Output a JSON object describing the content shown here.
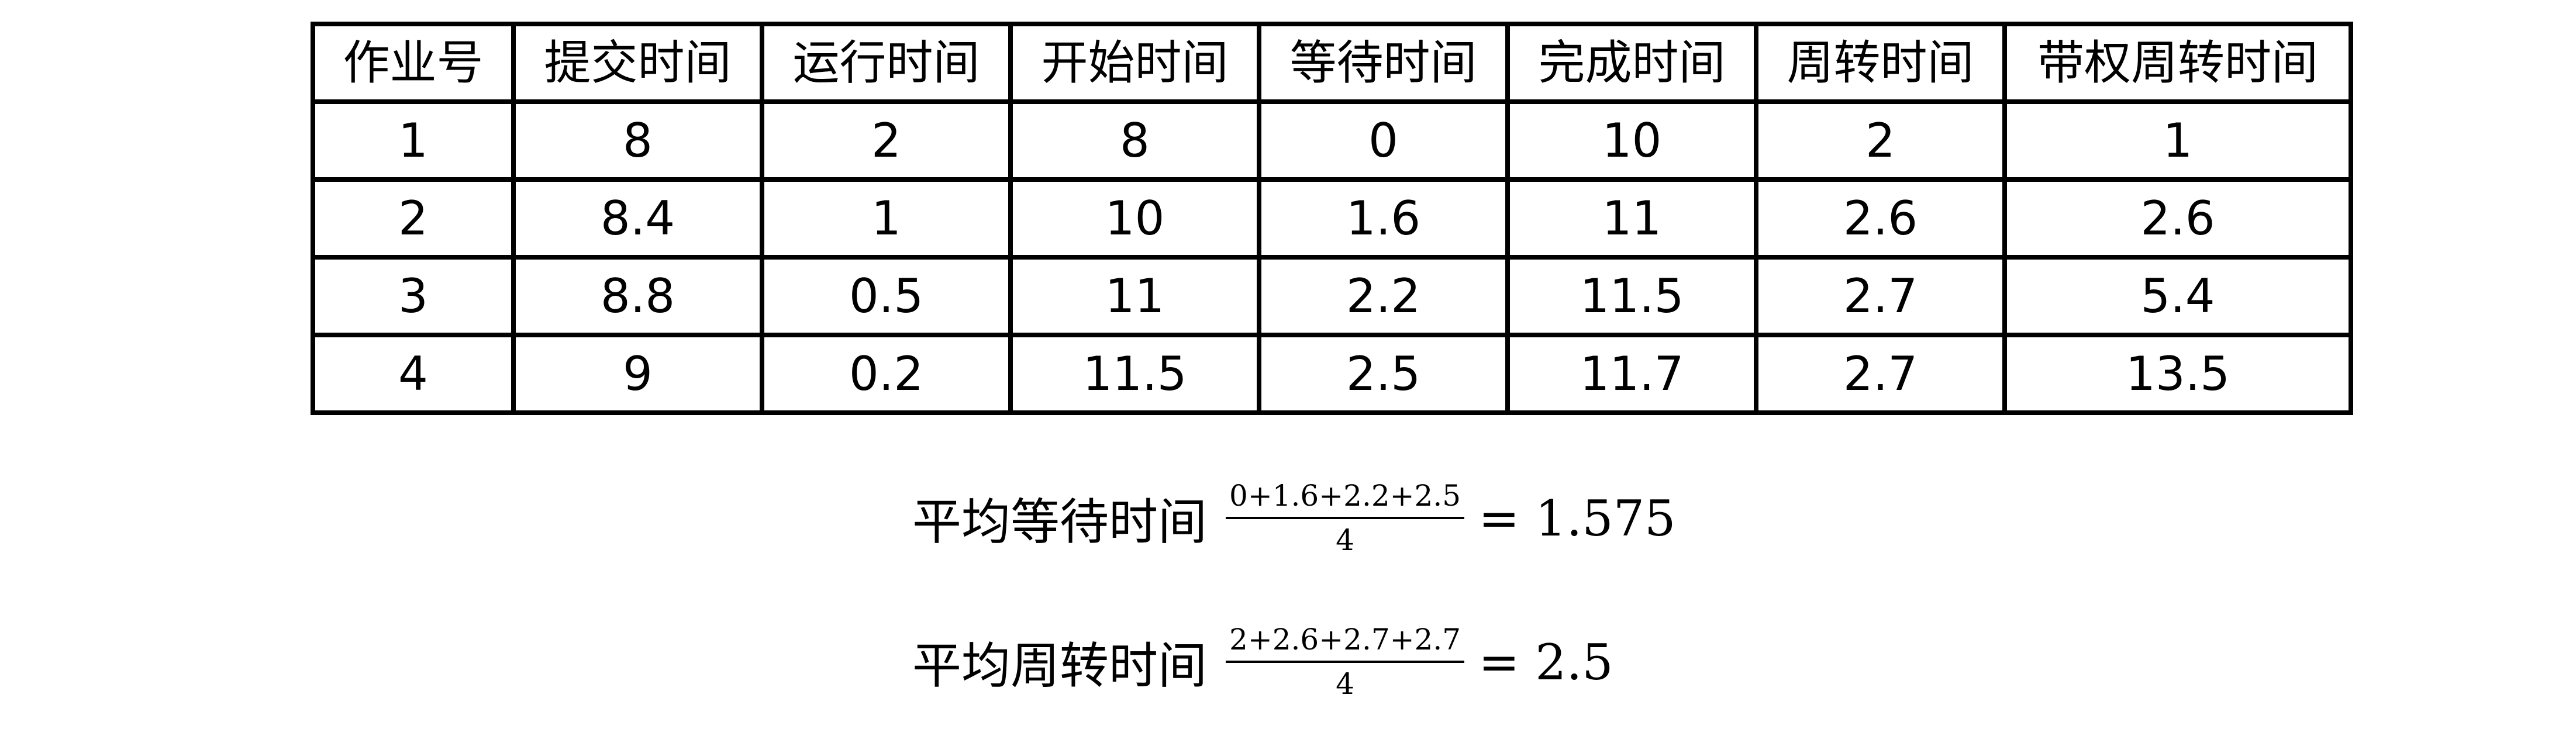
{
  "table": {
    "headers": [
      "作业号",
      "提交时间",
      "运行时间",
      "开始时间",
      "等待时间",
      "完成时间",
      "周转时间",
      "带权周转时间"
    ],
    "rows": [
      [
        "1",
        "8",
        "2",
        "8",
        "0",
        "10",
        "2",
        "1"
      ],
      [
        "2",
        "8.4",
        "1",
        "10",
        "1.6",
        "11",
        "2.6",
        "2.6"
      ],
      [
        "3",
        "8.8",
        "0.5",
        "11",
        "2.2",
        "11.5",
        "2.7",
        "5.4"
      ],
      [
        "4",
        "9",
        "0.2",
        "11.5",
        "2.5",
        "11.7",
        "2.7",
        "13.5"
      ]
    ]
  },
  "avg_wait": {
    "label": "平均等待时间",
    "numerator": "0+1.6+2.2+2.5",
    "denominator": "4",
    "equals": "= 1.575"
  },
  "avg_turnaround": {
    "label": "平均周转时间",
    "numerator": "2+2.6+2.7+2.7",
    "denominator": "4",
    "equals": "= 2.5"
  }
}
